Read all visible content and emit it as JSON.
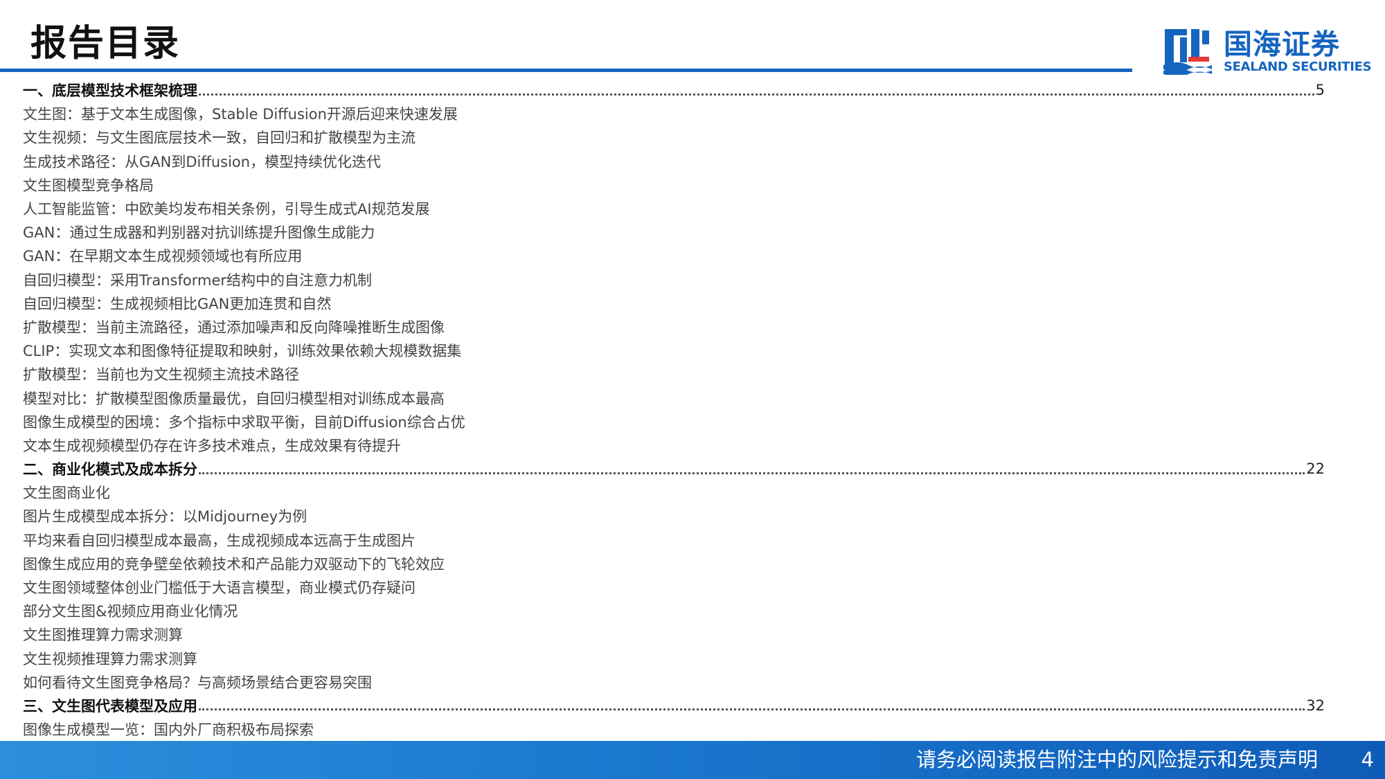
{
  "header": {
    "title": "报告目录"
  },
  "logo": {
    "chinese_name": "国海证券",
    "english_name": "SEALAND SECURITIES",
    "brand_color": "#1565c0",
    "accent_color": "#e53935"
  },
  "toc": [
    {
      "type": "section",
      "text": "一、底层模型技术框架梳理",
      "page": "5"
    },
    {
      "type": "item",
      "text": "文生图：基于文本生成图像，Stable Diffusion开源后迎来快速发展"
    },
    {
      "type": "item",
      "text": "文生视频：与文生图底层技术一致，自回归和扩散模型为主流"
    },
    {
      "type": "item",
      "text": "生成技术路径：从GAN到Diffusion，模型持续优化迭代"
    },
    {
      "type": "item",
      "text": "文生图模型竞争格局"
    },
    {
      "type": "item",
      "text": "人工智能监管：中欧美均发布相关条例，引导生成式AI规范发展"
    },
    {
      "type": "item",
      "text": "GAN：通过生成器和判别器对抗训练提升图像生成能力"
    },
    {
      "type": "item",
      "text": "GAN：在早期文本生成视频领域也有所应用"
    },
    {
      "type": "item",
      "text": "自回归模型：采用Transformer结构中的自注意力机制"
    },
    {
      "type": "item",
      "text": "自回归模型：生成视频相比GAN更加连贯和自然"
    },
    {
      "type": "item",
      "text": "扩散模型：当前主流路径，通过添加噪声和反向降噪推断生成图像"
    },
    {
      "type": "item",
      "text": "CLIP：实现文本和图像特征提取和映射，训练效果依赖大规模数据集"
    },
    {
      "type": "item",
      "text": "扩散模型：当前也为文生视频主流技术路径"
    },
    {
      "type": "item",
      "text": "模型对比：扩散模型图像质量最优，自回归模型相对训练成本最高"
    },
    {
      "type": "item",
      "text": "图像生成模型的困境：多个指标中求取平衡，目前Diffusion综合占优"
    },
    {
      "type": "item",
      "text": "文本生成视频模型仍存在许多技术难点，生成效果有待提升"
    },
    {
      "type": "section",
      "text": "二、商业化模式及成本拆分",
      "page": "22"
    },
    {
      "type": "item",
      "text": "文生图商业化"
    },
    {
      "type": "item",
      "text": "图片生成模型成本拆分：以Midjourney为例"
    },
    {
      "type": "item",
      "text": "平均来看自回归模型成本最高，生成视频成本远高于生成图片"
    },
    {
      "type": "item",
      "text": "图像生成应用的竞争壁垒依赖技术和产品能力双驱动下的飞轮效应"
    },
    {
      "type": "item",
      "text": "文生图领域整体创业门槛低于大语言模型，商业模式仍存疑问"
    },
    {
      "type": "item",
      "text": "部分文生图&视频应用商业化情况"
    },
    {
      "type": "item",
      "text": "文生图推理算力需求测算"
    },
    {
      "type": "item",
      "text": "文生视频推理算力需求测算"
    },
    {
      "type": "item",
      "text": "如何看待文生图竞争格局？与高频场景结合更容易突围"
    },
    {
      "type": "section",
      "text": "三、文生图代表模型及应用",
      "page": "32"
    },
    {
      "type": "item",
      "text": "图像生成模型一览：国内外厂商积极布局探索"
    }
  ],
  "footer": {
    "disclaimer": "请务必阅读报告附注中的风险提示和免责声明",
    "page_number": "4"
  }
}
